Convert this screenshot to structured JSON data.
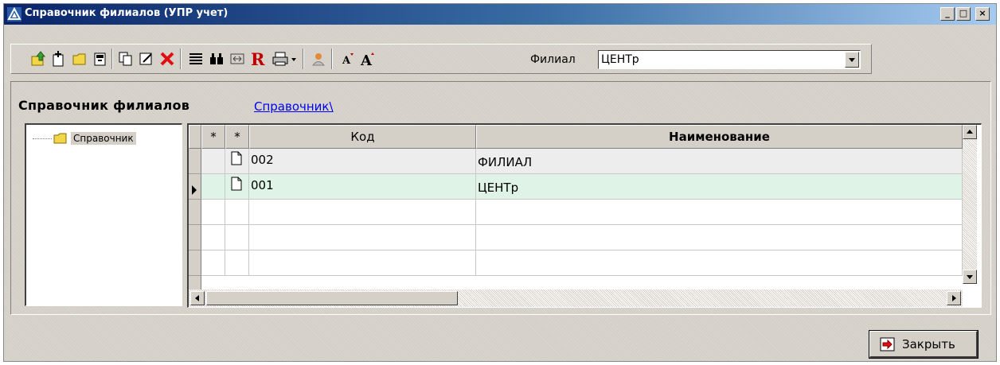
{
  "window": {
    "title": "Справочник филиалов (УПР учет)",
    "minimize_label": "_",
    "maximize_label": "□",
    "close_label": "×"
  },
  "toolbar": {
    "filial_label": "Филиал",
    "filial_value": "ЦЕНТр",
    "icons": [
      "up-folder-icon",
      "add-child-icon",
      "new-folder-icon",
      "add-record-icon",
      "copy-icon",
      "edit-icon",
      "delete-icon",
      "list-icon",
      "binoculars-icon",
      "fit-width-icon",
      "r-icon",
      "printer-icon",
      "user-icon",
      "font-decrease-icon",
      "font-increase-icon"
    ],
    "colors": {
      "delete": "#e01010",
      "r": "#c00000",
      "folder": "#f2d64a"
    }
  },
  "header": {
    "caption": "Справочник филиалов",
    "breadcrumb": "Справочник\\"
  },
  "tree": {
    "items": [
      {
        "label": "Справочник"
      }
    ]
  },
  "grid": {
    "columns": [
      "*",
      "*",
      "Код",
      "Наименование"
    ],
    "rows": [
      {
        "code": "002",
        "name": "ФИЛИАЛ",
        "selected": false
      },
      {
        "code": "001",
        "name": "ЦЕНТр",
        "selected": true
      }
    ],
    "selected_row_color": "#dff3e6",
    "first_row_color": "#ededed"
  },
  "footer": {
    "close_label": "Закрыть"
  }
}
